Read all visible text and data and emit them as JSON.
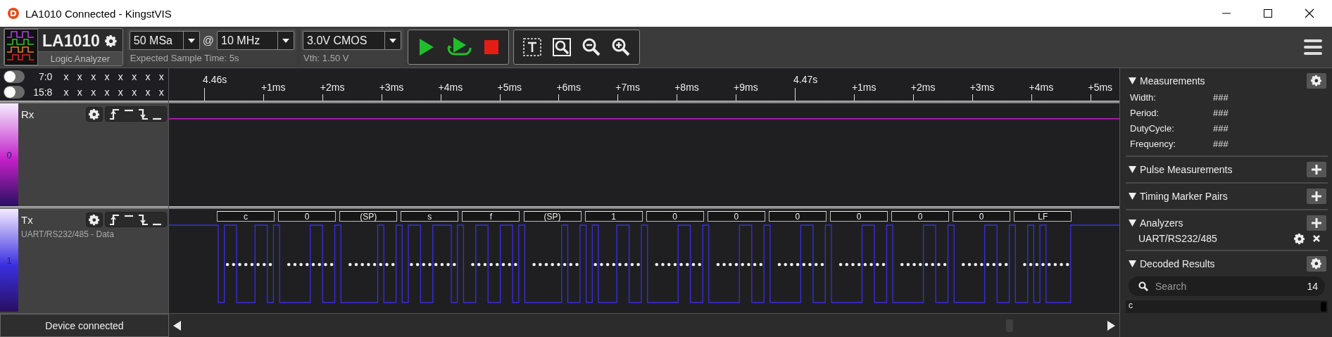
{
  "window": {
    "title": "LA1010 Connected - KingstVIS"
  },
  "toolbar": {
    "device": {
      "name": "LA1010",
      "subtitle": "Logic Analyzer"
    },
    "sample_depth": "50 MSa",
    "at": "@",
    "sample_rate": "10 MHz",
    "expected_time": "Expected Sample Time: 5s",
    "voltage": "3.0V CMOS",
    "vth": "Vth: 1.50 V"
  },
  "channel_groups": [
    {
      "label": "7:0",
      "on": false,
      "bits": [
        "x",
        "x",
        "x",
        "x",
        "x",
        "x",
        "x",
        "x"
      ]
    },
    {
      "label": "15:8",
      "on": false,
      "bits": [
        "x",
        "x",
        "x",
        "x",
        "x",
        "x",
        "x",
        "x"
      ]
    }
  ],
  "ruler": {
    "ticks": [
      {
        "label": "4.46s",
        "kind": "major"
      },
      {
        "label": "+1ms",
        "kind": "minor"
      },
      {
        "label": "+2ms",
        "kind": "minor"
      },
      {
        "label": "+3ms",
        "kind": "minor"
      },
      {
        "label": "+4ms",
        "kind": "minor"
      },
      {
        "label": "+5ms",
        "kind": "minor"
      },
      {
        "label": "+6ms",
        "kind": "minor"
      },
      {
        "label": "+7ms",
        "kind": "minor"
      },
      {
        "label": "+8ms",
        "kind": "minor"
      },
      {
        "label": "+9ms",
        "kind": "minor"
      },
      {
        "label": "4.47s",
        "kind": "major"
      },
      {
        "label": "+1ms",
        "kind": "minor"
      },
      {
        "label": "+2ms",
        "kind": "minor"
      },
      {
        "label": "+3ms",
        "kind": "minor"
      },
      {
        "label": "+4ms",
        "kind": "minor"
      },
      {
        "label": "+5ms",
        "kind": "minor"
      }
    ]
  },
  "channels": [
    {
      "index": "0",
      "name": "Rx",
      "color": "#c21fc8"
    },
    {
      "index": "1",
      "name": "Tx",
      "color": "#3a2fe0",
      "analyzer": "UART/RS232/485 - Data",
      "decoded": [
        "c",
        "0",
        "(SP)",
        "s",
        "f",
        "(SP)",
        "1",
        "0",
        "0",
        "0",
        "0",
        "0",
        "0",
        "LF"
      ]
    }
  ],
  "sidebar": {
    "sections": [
      {
        "title": "Measurements",
        "expanded": true,
        "kind": "settings",
        "rows": [
          {
            "label": "Width:",
            "value": "###"
          },
          {
            "label": "Period:",
            "value": "###"
          },
          {
            "label": "DutyCycle:",
            "value": "###"
          },
          {
            "label": "Frequency:",
            "value": "###"
          }
        ]
      },
      {
        "title": "Pulse Measurements",
        "expanded": true,
        "kind": "add"
      },
      {
        "title": "Timing Marker Pairs",
        "expanded": true,
        "kind": "add"
      },
      {
        "title": "Analyzers",
        "expanded": true,
        "kind": "add",
        "analyzers": [
          "UART/RS232/485"
        ]
      },
      {
        "title": "Decoded Results",
        "expanded": true,
        "kind": "settings",
        "search": {
          "placeholder": "Search",
          "count": "14"
        },
        "results": [
          "c"
        ]
      }
    ]
  },
  "status_bar": {
    "status": "Device connected"
  }
}
